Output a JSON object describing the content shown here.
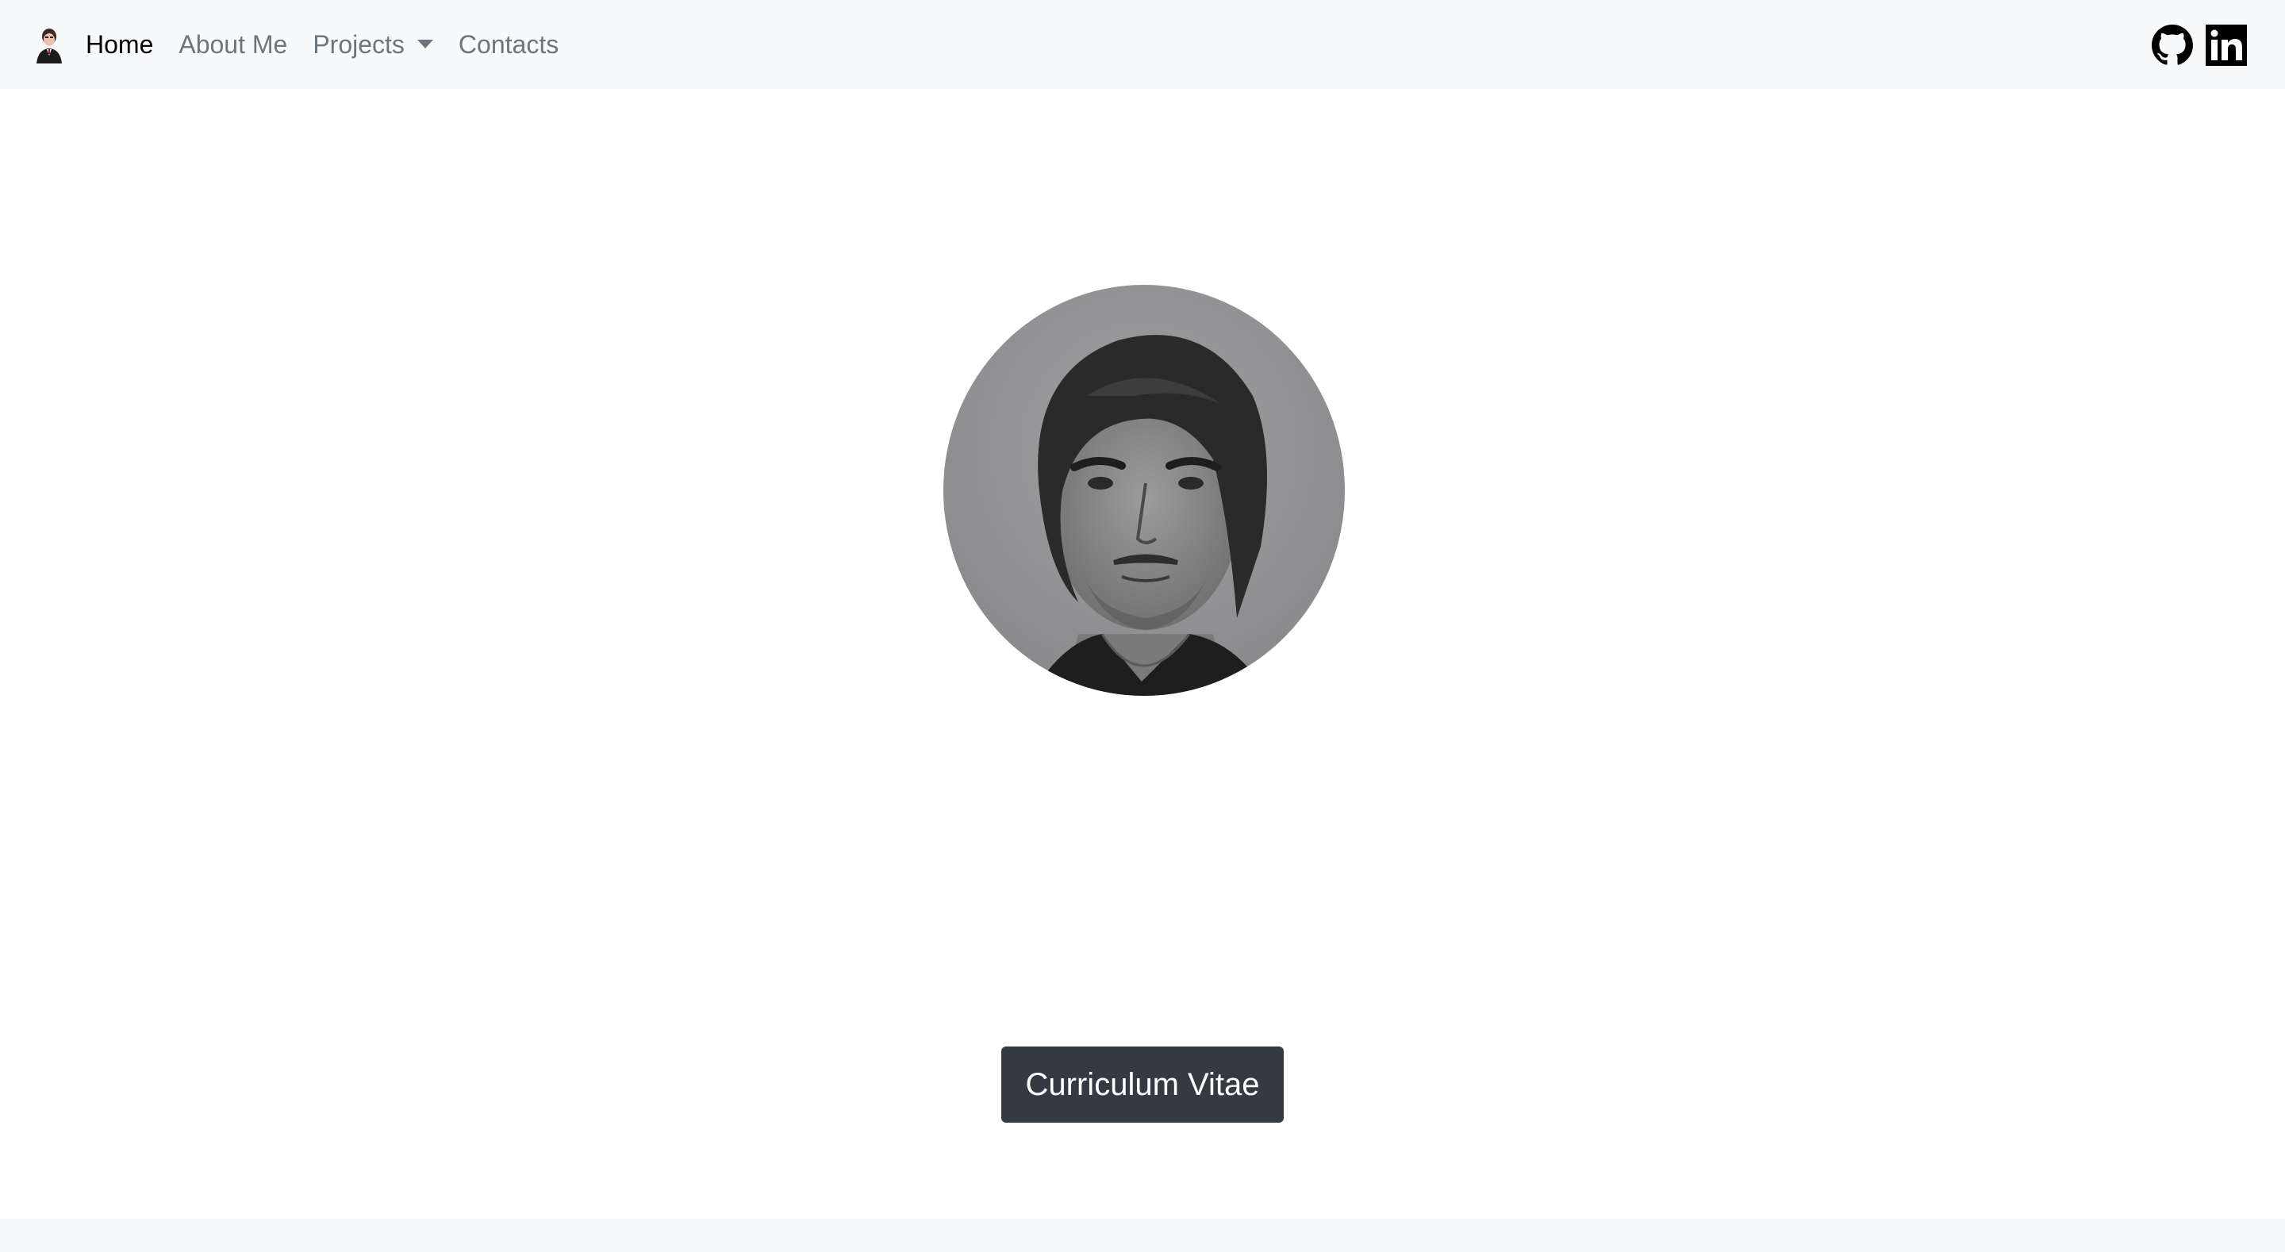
{
  "nav": {
    "brand_icon": "avatar-brand-icon",
    "links": {
      "home": "Home",
      "about": "About Me",
      "projects": "Projects",
      "contacts": "Contacts"
    },
    "active": "home",
    "social": [
      "github-icon",
      "linkedin-icon"
    ]
  },
  "hero": {
    "portrait_icon": "profile-portrait",
    "cv_button": "Curriculum Vitae"
  },
  "colors": {
    "navbar_bg": "#f8f9fa",
    "active_link": "#000000",
    "link": "#6c757d",
    "button_bg": "#343a40",
    "button_text": "#ffffff"
  }
}
